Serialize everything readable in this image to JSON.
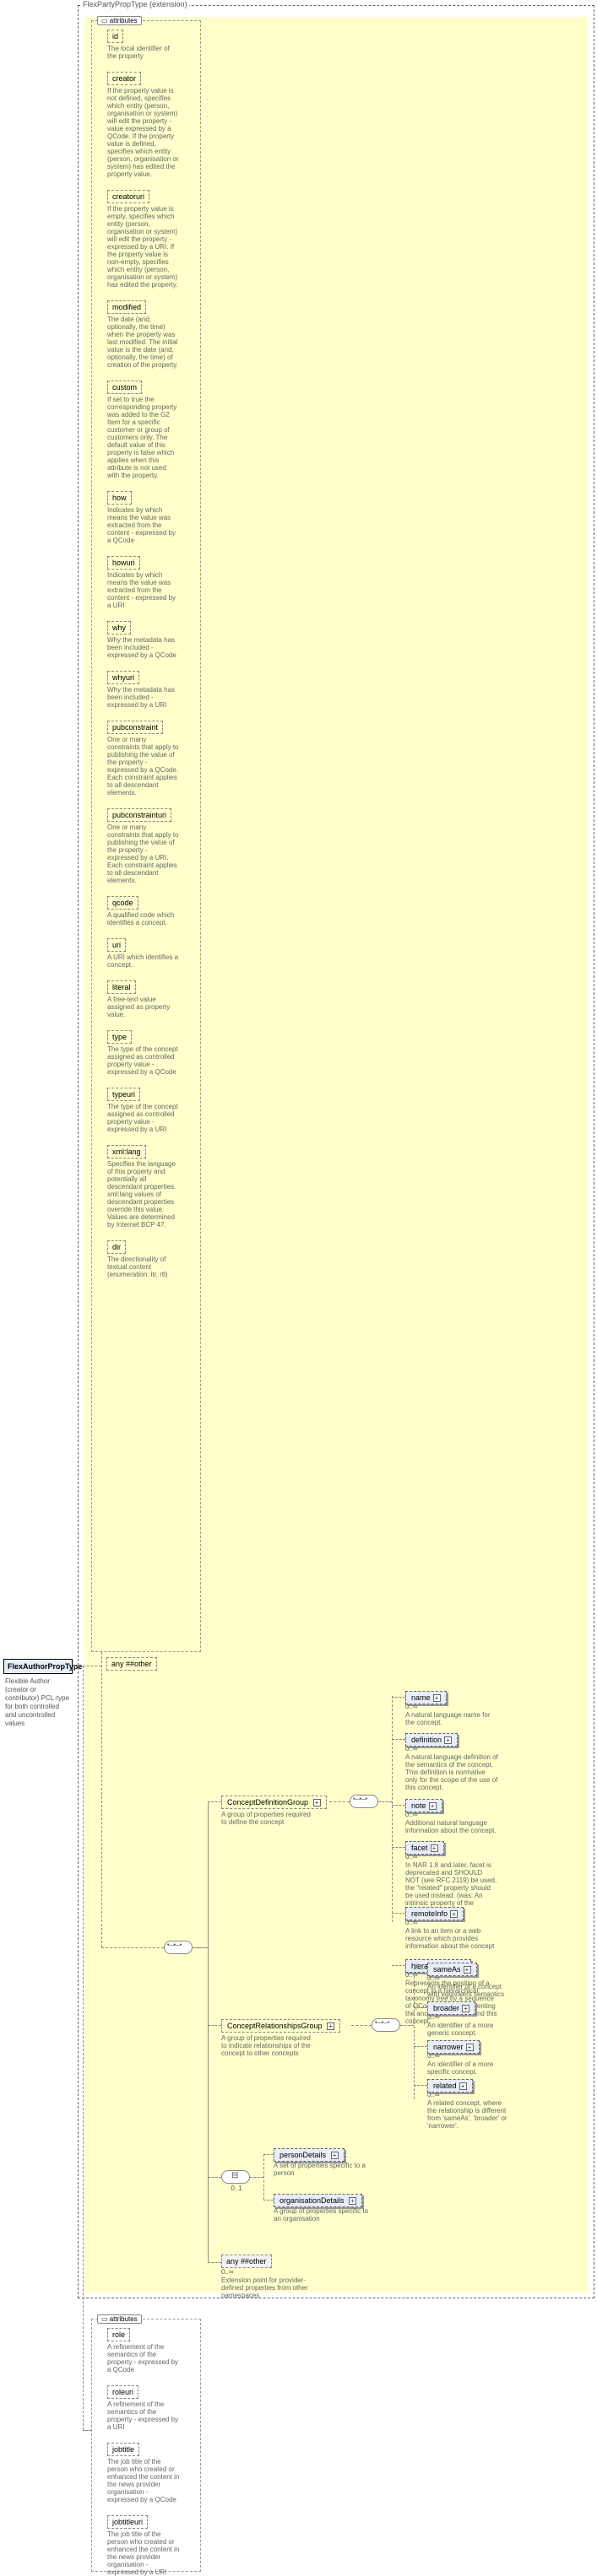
{
  "root": {
    "name": "FlexAuthorPropType",
    "desc": "Flexible Author (creator or contributor) PCL-type for both controlled and uncontrolled values"
  },
  "ext": {
    "label": "FlexPartyPropType (extension)"
  },
  "attrs_label": "attributes",
  "attrs": [
    {
      "name": "id",
      "desc": "The local identifier of the property"
    },
    {
      "name": "creator",
      "desc": "If the property value is not defined, specifies which entity (person, organisation or system) will edit the property - value expressed by a QCode. If the property value is defined, specifies which entity (person, organisation or system) has edited the property value."
    },
    {
      "name": "creatoruri",
      "desc": "If the property value is empty, specifies which entity (person, organisation or system) will edit the property - expressed by a URI. If the property value is non-empty, specifies which entity (person, organisation or system) has edited the property."
    },
    {
      "name": "modified",
      "desc": "The date (and, optionally, the time) when the property was last modified. The initial value is the date (and, optionally, the time) of creation of the property."
    },
    {
      "name": "custom",
      "desc": "If set to true the corresponding property was added to the G2 Item for a specific customer or group of customers only. The default value of this property is false which applies when this attribute is not used with the property."
    },
    {
      "name": "how",
      "desc": "Indicates by which means the value was extracted from the content - expressed by a QCode"
    },
    {
      "name": "howuri",
      "desc": "Indicates by which means the value was extracted from the content - expressed by a URI"
    },
    {
      "name": "why",
      "desc": "Why the metadata has been included - expressed by a QCode"
    },
    {
      "name": "whyuri",
      "desc": "Why the metadata has been included - expressed by a URI"
    },
    {
      "name": "pubconstraint",
      "desc": "One or many constraints that apply to publishing the value of the property - expressed by a QCode. Each constraint applies to all descendant elements."
    },
    {
      "name": "pubconstrainturi",
      "desc": "One or many constraints that apply to publishing the value of the property - expressed by a URI. Each constraint applies to all descendant elements."
    },
    {
      "name": "qcode",
      "desc": "A qualified code which identifies a concept."
    },
    {
      "name": "uri",
      "desc": "A URI which identifies a concept."
    },
    {
      "name": "literal",
      "desc": "A free-text value assigned as property value."
    },
    {
      "name": "type",
      "desc": "The type of the concept assigned as controlled property value - expressed by a QCode"
    },
    {
      "name": "typeuri",
      "desc": "The type of the concept assigned as controlled property value - expressed by a URI"
    },
    {
      "name": "xml:lang",
      "desc": "Specifies the language of this property and potentially all descendant properties. xml:lang values of descendant properties override this value. Values are determined by Internet BCP 47."
    },
    {
      "name": "dir",
      "desc": "The directionality of textual content (enumeration: ltr, rtl)"
    }
  ],
  "any1": {
    "label": "any ##other"
  },
  "groups": {
    "def": {
      "name": "ConceptDefinitionGroup",
      "desc": "A group of properties required to define the concept"
    },
    "rel": {
      "name": "ConceptRelationshipsGroup",
      "desc": "A group of properties required to indicate relationships of the concept to other concepts"
    }
  },
  "def_children": [
    {
      "name": "name",
      "desc": "A natural language name for the concept."
    },
    {
      "name": "definition",
      "desc": "A natural language definition of the semantics of the concept. This definition is normative only for the scope of the use of this concept."
    },
    {
      "name": "note",
      "desc": "Additional natural language information about the concept."
    },
    {
      "name": "facet",
      "desc": "In NAR 1.8 and later, facet is deprecated and SHOULD NOT (see RFC 2119) be used, the \"related\" property should be used instead. (was: An intrinsic property of the concept.)"
    },
    {
      "name": "remoteInfo",
      "desc": "A link to an item or a web resource which provides information about the concept"
    },
    {
      "name": "hierarchyInfo",
      "desc": "Represents the position of a concept in a hierarchical taxonomy tree by a sequence of QCode tokens representing the ancestor concepts and this concept"
    }
  ],
  "rel_children": [
    {
      "name": "sameAs",
      "desc": "An identifier of a concept with equivalent semantics"
    },
    {
      "name": "broader",
      "desc": "An identifier of a more generic concept."
    },
    {
      "name": "narrower",
      "desc": "An identifier of a more specific concept."
    },
    {
      "name": "related",
      "desc": "A related concept, where the relationship is different from 'sameAs', 'broader' or 'narrower'."
    }
  ],
  "choice_children": [
    {
      "name": "personDetails",
      "desc": "A set of properties specific to a person"
    },
    {
      "name": "organisationDetails",
      "desc": "A group of properties specific to an organisation"
    }
  ],
  "any2": {
    "label": "any ##other",
    "desc": "Extension point for provider-defined properties from other namespaces",
    "occ": "0..∞"
  },
  "bottom_attrs": [
    {
      "name": "role",
      "desc": "A refinement of the semantics of the property - expressed by a QCode"
    },
    {
      "name": "roleuri",
      "desc": "A refinement of the semantics of the property - expressed by a URI"
    },
    {
      "name": "jobtitle",
      "desc": "The job title of the person who created or enhanced the content in the news provider organisation - expressed by a QCode"
    },
    {
      "name": "jobtitleuri",
      "desc": "The job title of the person who created or enhanced the content in the news provider organisation - expressed by a URI"
    }
  ],
  "occ": {
    "zero_inf": "0..∞",
    "zero_one": "0..1"
  },
  "plus": "+"
}
